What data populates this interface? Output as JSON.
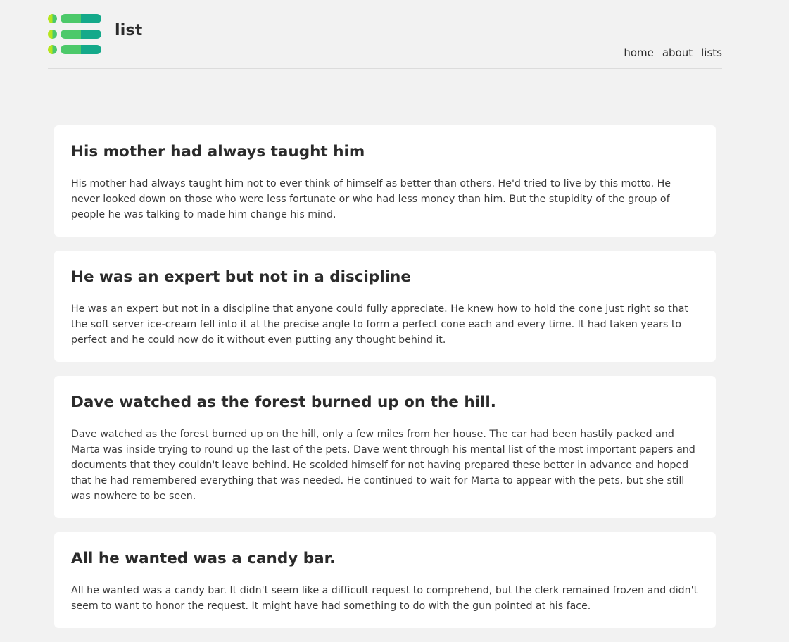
{
  "brand": {
    "name": "list",
    "logo_icon": "list-logo-icon",
    "colors": [
      "#7ed321",
      "#4cc96a",
      "#14a98a"
    ]
  },
  "nav": {
    "items": [
      {
        "label": "home"
      },
      {
        "label": "about"
      },
      {
        "label": "lists"
      }
    ]
  },
  "posts": [
    {
      "title": "His mother had always taught him",
      "body": "His mother had always taught him not to ever think of himself as better than others. He'd tried to live by this motto. He never looked down on those who were less fortunate or who had less money than him. But the stupidity of the group of people he was talking to made him change his mind."
    },
    {
      "title": "He was an expert but not in a discipline",
      "body": "He was an expert but not in a discipline that anyone could fully appreciate. He knew how to hold the cone just right so that the soft server ice-cream fell into it at the precise angle to form a perfect cone each and every time. It had taken years to perfect and he could now do it without even putting any thought behind it."
    },
    {
      "title": "Dave watched as the forest burned up on the hill.",
      "body": "Dave watched as the forest burned up on the hill, only a few miles from her house. The car had been hastily packed and Marta was inside trying to round up the last of the pets. Dave went through his mental list of the most important papers and documents that they couldn't leave behind. He scolded himself for not having prepared these better in advance and hoped that he had remembered everything that was needed. He continued to wait for Marta to appear with the pets, but she still was nowhere to be seen."
    },
    {
      "title": "All he wanted was a candy bar.",
      "body": "All he wanted was a candy bar. It didn't seem like a difficult request to comprehend, but the clerk remained frozen and didn't seem to want to honor the request. It might have had something to do with the gun pointed at his face."
    }
  ]
}
